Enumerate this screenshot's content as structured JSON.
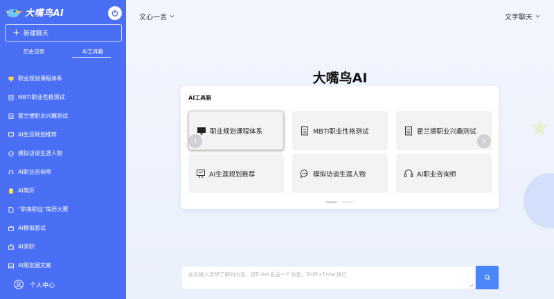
{
  "app": {
    "logo_text": "大嘴鸟AI"
  },
  "sidebar": {
    "new_chat_label": "新建聊天",
    "tabs": [
      {
        "label": "历史记录"
      },
      {
        "label": "AI工具箱"
      }
    ],
    "items": [
      {
        "label": "职业规划课程体系",
        "icon": "monitor-icon"
      },
      {
        "label": "MBTI职业性格测试",
        "icon": "document-icon"
      },
      {
        "label": "霍兰德职业兴趣测试",
        "icon": "document-icon"
      },
      {
        "label": "AI生涯规划推荐",
        "icon": "presentation-icon"
      },
      {
        "label": "模拟访谈生涯人物",
        "icon": "chat-bubble-icon"
      },
      {
        "label": "AI职业咨询师",
        "icon": "headset-icon"
      },
      {
        "label": "AI简历",
        "icon": "clipboard-icon"
      },
      {
        "label": "“职来职往”简历大赛",
        "icon": "document-icon"
      },
      {
        "label": "AI模拟面试",
        "icon": "briefcase-icon"
      },
      {
        "label": "AI求职",
        "icon": "briefcase-icon"
      },
      {
        "label": "AI朋友圈文案",
        "icon": "image-icon"
      }
    ],
    "user_center_label": "个人中心"
  },
  "header": {
    "model_label": "文心一言",
    "mode_label": "文字聊天"
  },
  "main": {
    "heading": "大嘴鸟AI",
    "toolbox_title": "AI工具箱",
    "tools": [
      {
        "label": "职业规划课程体系",
        "icon": "monitor-icon"
      },
      {
        "label": "MBTI职业性格测试",
        "icon": "document-icon"
      },
      {
        "label": "霍兰德职业兴趣测试",
        "icon": "document-icon"
      },
      {
        "label": "AI生涯规划推荐",
        "icon": "presentation-icon"
      },
      {
        "label": "模拟访谈生涯人物",
        "icon": "chat-bubble-icon"
      },
      {
        "label": "AI职业咨询师",
        "icon": "headset-icon"
      }
    ]
  },
  "input": {
    "placeholder": "在此输入您想了解的内容，按Enter发送一个消息，Shift+Enter换行"
  },
  "colors": {
    "sidebar_bg": "#4a6ff5",
    "send_button": "#4a86f7",
    "page_bg": "#eef3fc"
  }
}
